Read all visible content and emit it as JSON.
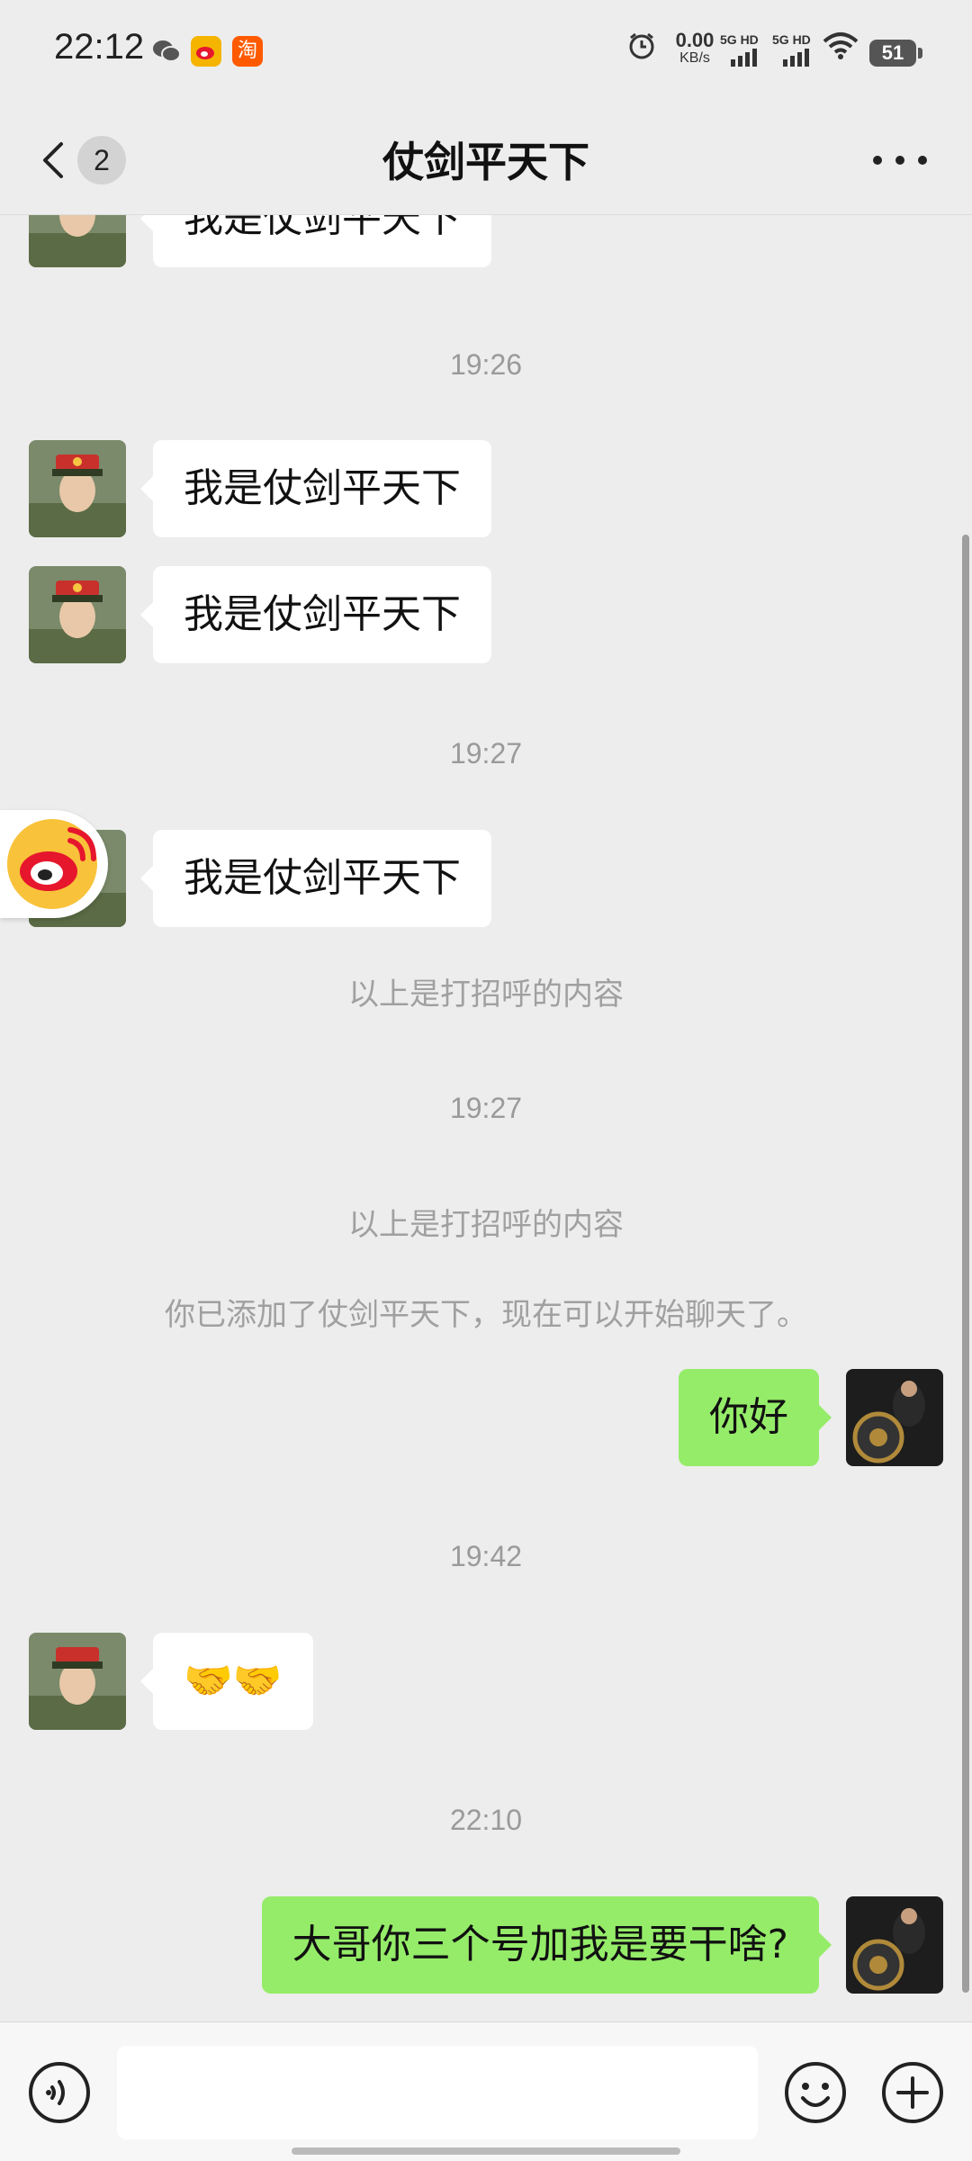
{
  "status_bar": {
    "time": "22:12",
    "apps": [
      "wechat-icon",
      "weibo-icon",
      "taobao-icon"
    ],
    "taobao_char": "淘",
    "net_speed_value": "0.00",
    "net_speed_unit": "KB/s",
    "sim1_label": "5G HD",
    "sim2_label": "5G HD",
    "battery": "51"
  },
  "header": {
    "unread_count": "2",
    "title": "仗剑平天下"
  },
  "messages": {
    "m0": "我是仗剑平天下",
    "t1": "19:26",
    "m1": "我是仗剑平天下",
    "m2": "我是仗剑平天下",
    "t2": "19:27",
    "m3": "我是仗剑平天下",
    "s1": "以上是打招呼的内容",
    "t3": "19:27",
    "s2": "以上是打招呼的内容",
    "s3": "你已添加了仗剑平天下，现在可以开始聊天了。",
    "m4": "你好",
    "t4": "19:42",
    "m5": "🤝🤝",
    "t5": "22:10",
    "m6": "大哥你三个号加我是要干啥?"
  },
  "colors": {
    "background": "#ededed",
    "outgoing_bubble": "#95ec69",
    "incoming_bubble": "#ffffff"
  }
}
